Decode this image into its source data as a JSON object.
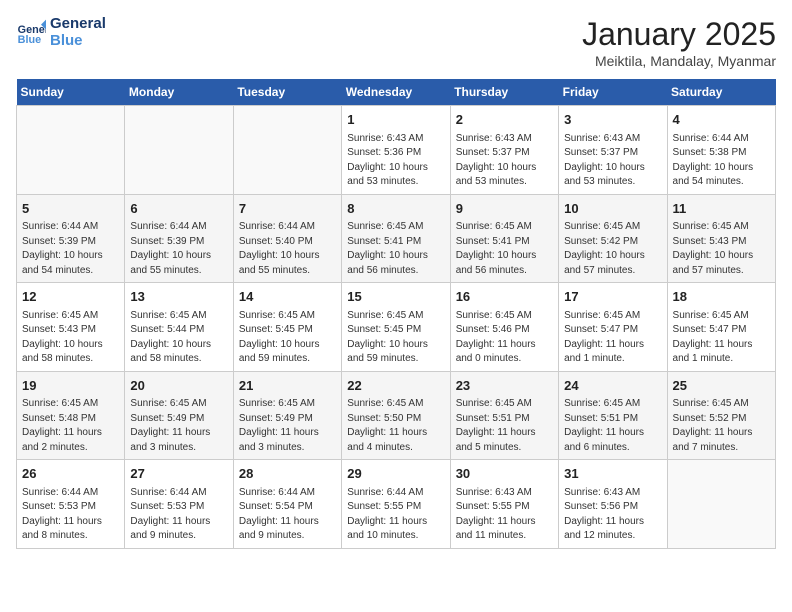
{
  "header": {
    "logo_line1": "General",
    "logo_line2": "Blue",
    "title": "January 2025",
    "subtitle": "Meiktila, Mandalay, Myanmar"
  },
  "weekdays": [
    "Sunday",
    "Monday",
    "Tuesday",
    "Wednesday",
    "Thursday",
    "Friday",
    "Saturday"
  ],
  "weeks": [
    [
      {
        "day": "",
        "info": ""
      },
      {
        "day": "",
        "info": ""
      },
      {
        "day": "",
        "info": ""
      },
      {
        "day": "1",
        "info": "Sunrise: 6:43 AM\nSunset: 5:36 PM\nDaylight: 10 hours\nand 53 minutes."
      },
      {
        "day": "2",
        "info": "Sunrise: 6:43 AM\nSunset: 5:37 PM\nDaylight: 10 hours\nand 53 minutes."
      },
      {
        "day": "3",
        "info": "Sunrise: 6:43 AM\nSunset: 5:37 PM\nDaylight: 10 hours\nand 53 minutes."
      },
      {
        "day": "4",
        "info": "Sunrise: 6:44 AM\nSunset: 5:38 PM\nDaylight: 10 hours\nand 54 minutes."
      }
    ],
    [
      {
        "day": "5",
        "info": "Sunrise: 6:44 AM\nSunset: 5:39 PM\nDaylight: 10 hours\nand 54 minutes."
      },
      {
        "day": "6",
        "info": "Sunrise: 6:44 AM\nSunset: 5:39 PM\nDaylight: 10 hours\nand 55 minutes."
      },
      {
        "day": "7",
        "info": "Sunrise: 6:44 AM\nSunset: 5:40 PM\nDaylight: 10 hours\nand 55 minutes."
      },
      {
        "day": "8",
        "info": "Sunrise: 6:45 AM\nSunset: 5:41 PM\nDaylight: 10 hours\nand 56 minutes."
      },
      {
        "day": "9",
        "info": "Sunrise: 6:45 AM\nSunset: 5:41 PM\nDaylight: 10 hours\nand 56 minutes."
      },
      {
        "day": "10",
        "info": "Sunrise: 6:45 AM\nSunset: 5:42 PM\nDaylight: 10 hours\nand 57 minutes."
      },
      {
        "day": "11",
        "info": "Sunrise: 6:45 AM\nSunset: 5:43 PM\nDaylight: 10 hours\nand 57 minutes."
      }
    ],
    [
      {
        "day": "12",
        "info": "Sunrise: 6:45 AM\nSunset: 5:43 PM\nDaylight: 10 hours\nand 58 minutes."
      },
      {
        "day": "13",
        "info": "Sunrise: 6:45 AM\nSunset: 5:44 PM\nDaylight: 10 hours\nand 58 minutes."
      },
      {
        "day": "14",
        "info": "Sunrise: 6:45 AM\nSunset: 5:45 PM\nDaylight: 10 hours\nand 59 minutes."
      },
      {
        "day": "15",
        "info": "Sunrise: 6:45 AM\nSunset: 5:45 PM\nDaylight: 10 hours\nand 59 minutes."
      },
      {
        "day": "16",
        "info": "Sunrise: 6:45 AM\nSunset: 5:46 PM\nDaylight: 11 hours\nand 0 minutes."
      },
      {
        "day": "17",
        "info": "Sunrise: 6:45 AM\nSunset: 5:47 PM\nDaylight: 11 hours\nand 1 minute."
      },
      {
        "day": "18",
        "info": "Sunrise: 6:45 AM\nSunset: 5:47 PM\nDaylight: 11 hours\nand 1 minute."
      }
    ],
    [
      {
        "day": "19",
        "info": "Sunrise: 6:45 AM\nSunset: 5:48 PM\nDaylight: 11 hours\nand 2 minutes."
      },
      {
        "day": "20",
        "info": "Sunrise: 6:45 AM\nSunset: 5:49 PM\nDaylight: 11 hours\nand 3 minutes."
      },
      {
        "day": "21",
        "info": "Sunrise: 6:45 AM\nSunset: 5:49 PM\nDaylight: 11 hours\nand 3 minutes."
      },
      {
        "day": "22",
        "info": "Sunrise: 6:45 AM\nSunset: 5:50 PM\nDaylight: 11 hours\nand 4 minutes."
      },
      {
        "day": "23",
        "info": "Sunrise: 6:45 AM\nSunset: 5:51 PM\nDaylight: 11 hours\nand 5 minutes."
      },
      {
        "day": "24",
        "info": "Sunrise: 6:45 AM\nSunset: 5:51 PM\nDaylight: 11 hours\nand 6 minutes."
      },
      {
        "day": "25",
        "info": "Sunrise: 6:45 AM\nSunset: 5:52 PM\nDaylight: 11 hours\nand 7 minutes."
      }
    ],
    [
      {
        "day": "26",
        "info": "Sunrise: 6:44 AM\nSunset: 5:53 PM\nDaylight: 11 hours\nand 8 minutes."
      },
      {
        "day": "27",
        "info": "Sunrise: 6:44 AM\nSunset: 5:53 PM\nDaylight: 11 hours\nand 9 minutes."
      },
      {
        "day": "28",
        "info": "Sunrise: 6:44 AM\nSunset: 5:54 PM\nDaylight: 11 hours\nand 9 minutes."
      },
      {
        "day": "29",
        "info": "Sunrise: 6:44 AM\nSunset: 5:55 PM\nDaylight: 11 hours\nand 10 minutes."
      },
      {
        "day": "30",
        "info": "Sunrise: 6:43 AM\nSunset: 5:55 PM\nDaylight: 11 hours\nand 11 minutes."
      },
      {
        "day": "31",
        "info": "Sunrise: 6:43 AM\nSunset: 5:56 PM\nDaylight: 11 hours\nand 12 minutes."
      },
      {
        "day": "",
        "info": ""
      }
    ]
  ]
}
